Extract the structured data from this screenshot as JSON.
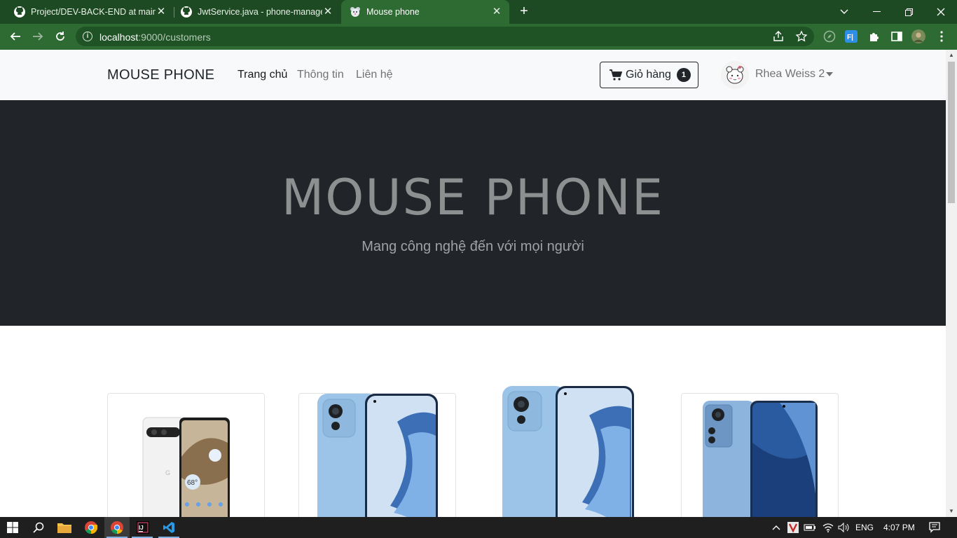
{
  "browser": {
    "tabs": [
      {
        "title": "Project/DEV-BACK-END at main · ",
        "active": false
      },
      {
        "title": "JwtService.java - phone-manager",
        "active": false
      },
      {
        "title": "Mouse phone",
        "active": true
      }
    ],
    "url_host": "localhost",
    "url_rest": ":9000/customers"
  },
  "navbar": {
    "brand": "MOUSE PHONE",
    "links": [
      "Trang chủ",
      "Thông tin",
      "Liên hệ"
    ],
    "cart_label": "Giỏ hàng",
    "cart_count": "1",
    "user_name": "Rhea Weiss 2"
  },
  "hero": {
    "title": "MOUSE PHONE",
    "subtitle": "Mang công nghệ đến với mọi người"
  },
  "products": [
    {
      "image": "white-google-pixel-phone"
    },
    {
      "image": "blue-xiaomi-phone"
    },
    {
      "image": "blue-xiaomi-phone"
    },
    {
      "image": "blue-xiaomi-12-phone"
    }
  ],
  "taskbar": {
    "language": "ENG",
    "time": "4:07 PM"
  },
  "colors": {
    "tabstrip": "#1d4a22",
    "toolbar": "#2e6b33",
    "hero_bg": "#212529",
    "navbar_bg": "#f8f9fa"
  }
}
